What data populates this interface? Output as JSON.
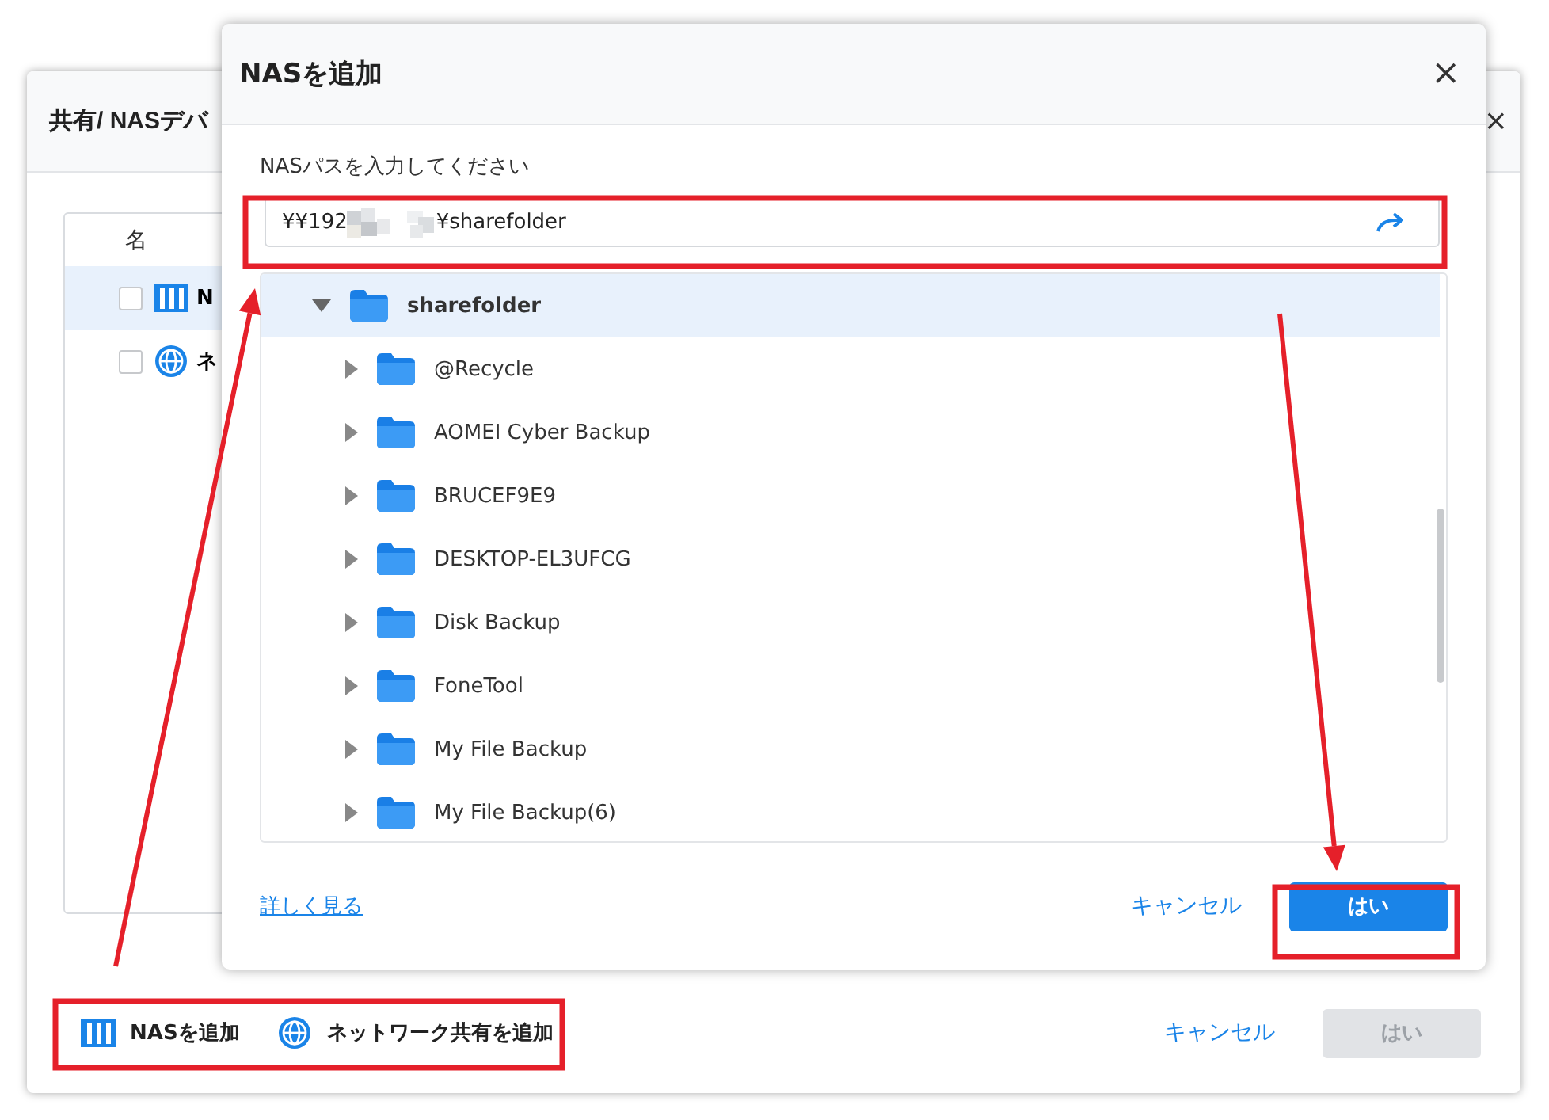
{
  "background_dialog": {
    "title": "共有/ NASデバ",
    "close": "×",
    "table": {
      "columns": [
        "名"
      ],
      "rows": [
        {
          "name": "N",
          "kind": "nas",
          "checked": false,
          "selected": true
        },
        {
          "name": "ネ",
          "kind": "network",
          "checked": false,
          "selected": false
        }
      ]
    },
    "footer_actions": [
      {
        "label": "NASを追加",
        "kind": "nas"
      },
      {
        "label": "ネットワーク共有を追加",
        "kind": "network"
      }
    ],
    "buttons": [
      {
        "label": "キャンセル",
        "kind": "link",
        "disabled": false
      },
      {
        "label": "はい",
        "kind": "primary",
        "disabled": true
      }
    ]
  },
  "nas_dialog": {
    "title": "NASを追加",
    "close": "×",
    "path_label": "NASパスを入力してください",
    "path_field": {
      "value_start": "¥¥192",
      "value_end": "¥sharefolder"
    },
    "tree": {
      "label": "sharefolder",
      "expanded": true,
      "selected": true,
      "children": [
        {
          "label": "@Recycle",
          "expanded": false,
          "selected": false
        },
        {
          "label": "AOMEI Cyber Backup",
          "expanded": false,
          "selected": false
        },
        {
          "label": "BRUCEF9E9",
          "expanded": false,
          "selected": false
        },
        {
          "label": "DESKTOP-EL3UFCG",
          "expanded": false,
          "selected": false
        },
        {
          "label": "Disk Backup",
          "expanded": false,
          "selected": false
        },
        {
          "label": "FoneTool",
          "expanded": false,
          "selected": false
        },
        {
          "label": "My File Backup",
          "expanded": false,
          "selected": false
        },
        {
          "label": "My File Backup(6)",
          "expanded": false,
          "selected": false
        }
      ]
    },
    "learn_more": "詳しく見る",
    "buttons": [
      {
        "label": "キャンセル",
        "kind": "link",
        "disabled": false
      },
      {
        "label": "はい",
        "kind": "primary",
        "disabled": false
      }
    ]
  }
}
